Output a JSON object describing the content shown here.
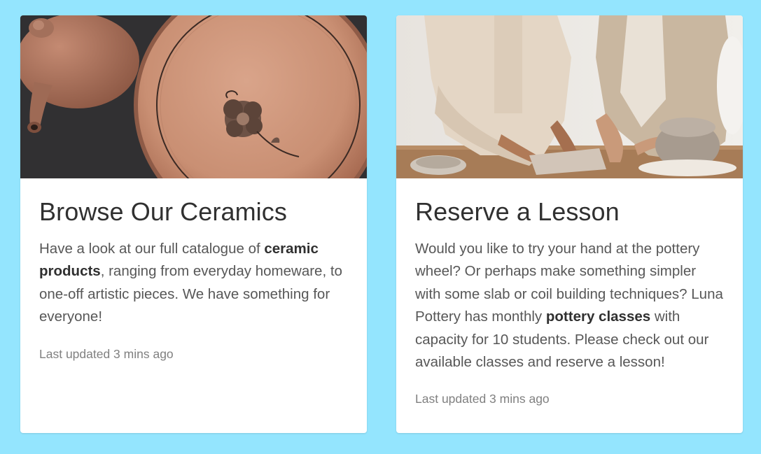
{
  "cards": [
    {
      "image": "teapot-and-plate-photo",
      "title": "Browse Our Ceramics",
      "text_before": "Have a look at our full catalogue of ",
      "link": "ceramic products",
      "text_after": ", ranging from everyday homeware, to one-off artistic pieces. We have something for everyone!",
      "updated": "Last updated 3 mins ago"
    },
    {
      "image": "pottery-class-photo",
      "title": "Reserve a Lesson",
      "text_before": "Would you like to try your hand at the pottery wheel? Or perhaps make something simpler with some slab or coil building techniques? Luna Pottery has monthly ",
      "link": "pottery classes",
      "text_after": " with capacity for 10 students. Please check out our available classes and reserve a lesson!",
      "updated": "Last updated 3 mins ago"
    }
  ],
  "colors": {
    "background": "#94e5fe",
    "card": "#ffffff",
    "title": "#303030",
    "body_text": "#575757",
    "meta_text": "#808080"
  }
}
